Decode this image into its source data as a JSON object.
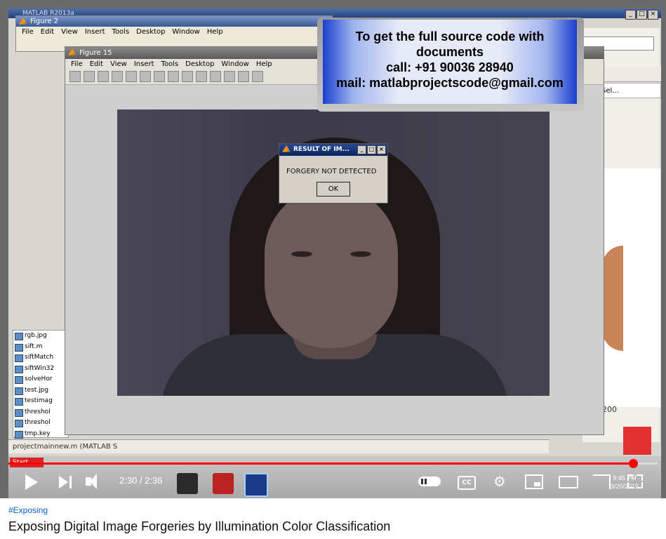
{
  "desktop": {
    "title": "MATLAB R2013a",
    "combo_value": "",
    "select_label": "Sel...",
    "axis_tick": "200",
    "status_text": "projectmainnew.m (MATLAB S",
    "files": [
      "rgb.jpg",
      "sift.m",
      "siftMatch",
      "siftWin32",
      "solveHor",
      "test.jpg",
      "testimag",
      "threshol",
      "threshol",
      "tmp.key"
    ],
    "start_label": "Start"
  },
  "figure2": {
    "title": "Figure 2",
    "menu": [
      "File",
      "Edit",
      "View",
      "Insert",
      "Tools",
      "Desktop",
      "Window",
      "Help"
    ]
  },
  "figure15": {
    "title": "Figure 15",
    "menu": [
      "File",
      "Edit",
      "View",
      "Insert",
      "Tools",
      "Desktop",
      "Window",
      "Help"
    ]
  },
  "dialog": {
    "title": "RESULT OF IM...",
    "message": "FORGERY NOT DETECTED",
    "ok_label": "OK"
  },
  "ad": {
    "line1": "To get the full source code with",
    "line2": "documents",
    "line3": "call: +91 90036 28940",
    "line4": "mail: matlabprojectscode@gmail.com"
  },
  "player": {
    "time": "2:30 / 2:36",
    "progress_fraction": 0.962,
    "cc_label": "CC",
    "clock_time": "9:45 PM",
    "clock_date": "3/20/2015"
  },
  "video": {
    "hashtag": "#Exposing",
    "title": "Exposing Digital Image Forgeries by Illumination Color Classification"
  },
  "colors": {
    "progress": "#ff0000",
    "link": "#065fd4",
    "ad_blue": "#1a3fcf"
  }
}
